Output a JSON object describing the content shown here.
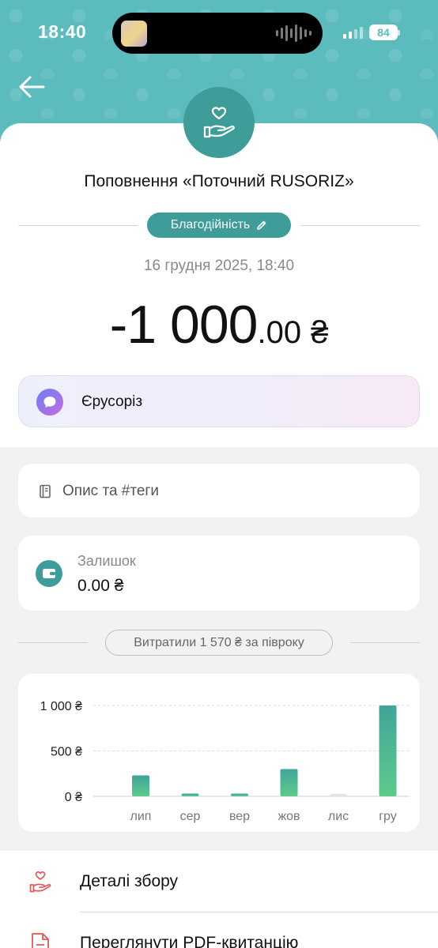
{
  "status_bar": {
    "time": "18:40",
    "battery": "84"
  },
  "header": {
    "title": "Поповнення «Поточний RUSORIZ»"
  },
  "category": {
    "label": "Благодійність"
  },
  "transaction": {
    "date": "16 грудня 2025, 18:40",
    "amount_main": "-1 000",
    "amount_cents": ".00",
    "currency": "₴"
  },
  "merchant": {
    "name": "Єрусоріз"
  },
  "description": {
    "placeholder": "Опис та #теги"
  },
  "balance": {
    "label": "Залишок",
    "value": "0.00 ₴"
  },
  "spending_summary": "Витратили 1 570 ₴ за півроку",
  "chart_data": {
    "type": "bar",
    "categories": [
      "лип",
      "сер",
      "вер",
      "жов",
      "лис",
      "гру"
    ],
    "values": [
      230,
      30,
      30,
      300,
      20,
      1000
    ],
    "y_ticks": [
      0,
      500,
      1000
    ],
    "y_tick_labels": [
      "0 ₴",
      "500 ₴",
      "1 000 ₴"
    ],
    "ylim": [
      0,
      1000
    ],
    "grid": true,
    "colors": {
      "bar_top": "#3fa59a",
      "bar_bottom": "#5ecb8a",
      "bar_empty": "#e4e4e4"
    }
  },
  "list": [
    {
      "label": "Деталі збору",
      "icon": "charity-hand-icon"
    },
    {
      "label": "Переглянути PDF-квитанцію",
      "icon": "pdf-document-icon"
    }
  ],
  "colors": {
    "accent": "#3e9c99",
    "header_bg": "#5bbbbd",
    "danger_icon": "#e05a5a"
  }
}
